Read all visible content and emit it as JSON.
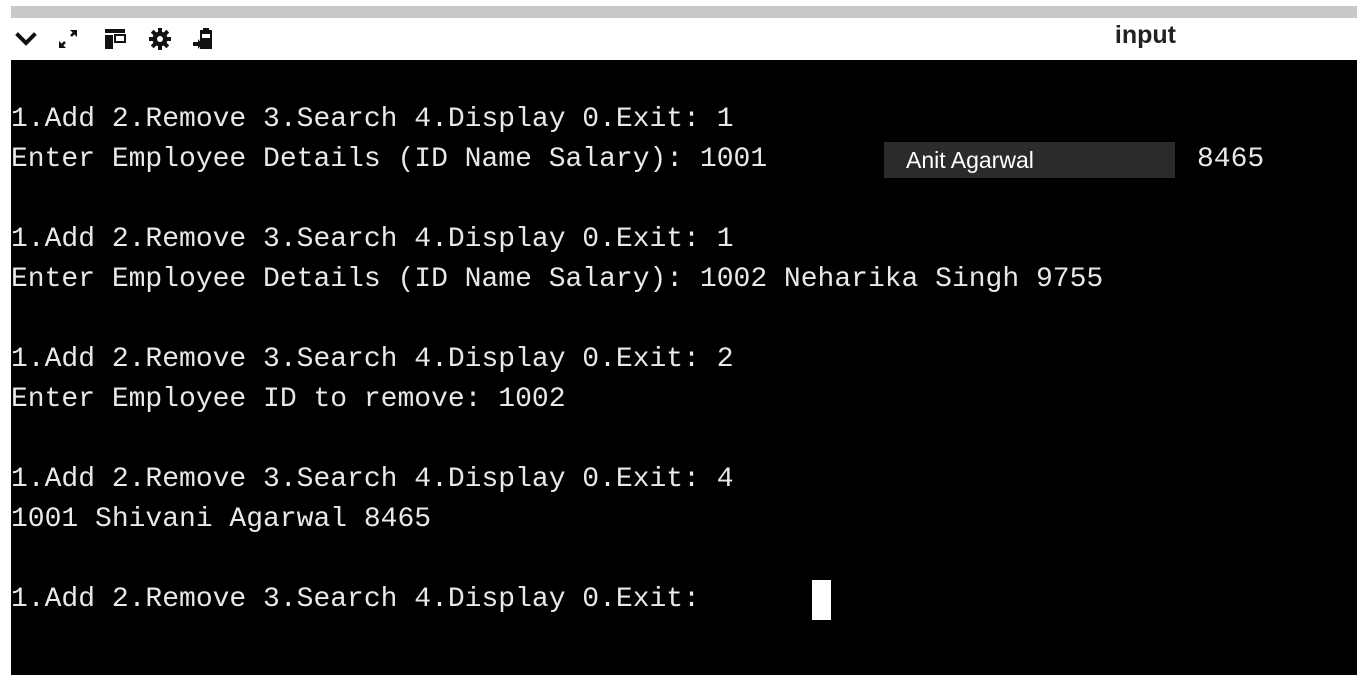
{
  "toolbar": {
    "panel_title": "input",
    "icons": [
      "chevron-down-icon",
      "expand-icon",
      "layout-icon",
      "gear-icon",
      "clipboard-icon"
    ]
  },
  "terminal": {
    "lines": [
      "1.Add 2.Remove 3.Search 4.Display 0.Exit: 1",
      "Enter Employee Details (ID Name Salary): 1001 ",
      "",
      "1.Add 2.Remove 3.Search 4.Display 0.Exit: 1",
      "Enter Employee Details (ID Name Salary): 1002 Neharika Singh 9755",
      "",
      "1.Add 2.Remove 3.Search 4.Display 0.Exit: 2",
      "Enter Employee ID to remove: 1002",
      "",
      "1.Add 2.Remove 3.Search 4.Display 0.Exit: 4",
      "1001 Shivani Agarwal 8465",
      "",
      "1.Add 2.Remove 3.Search 4.Display 0.Exit: "
    ],
    "overlay_field_value": "Anit Agarwal",
    "after_field_text": "8465"
  },
  "colors": {
    "terminal_bg": "#000000",
    "terminal_fg": "#e8e8e8",
    "topbar": "#c8c8c8",
    "field_bg": "#2b2b2b"
  }
}
